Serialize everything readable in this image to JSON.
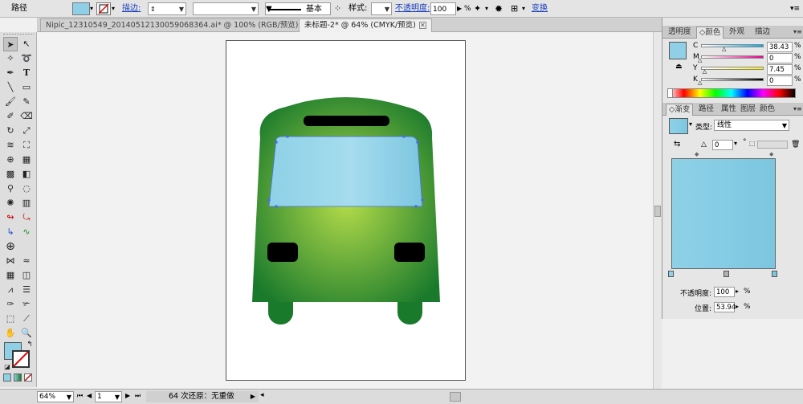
{
  "control_bar": {
    "object_type": "路径",
    "stroke_label": "描边:",
    "stroke_weight_value": "",
    "brush_label": "基本",
    "style_label": "样式:",
    "opacity_label": "不透明度:",
    "opacity_value": "100",
    "opacity_unit": "%",
    "transform_label": "变换"
  },
  "tabs": [
    {
      "label": "Nipic_12310549_20140512130059068364.ai* @ 100% (RGB/预览)"
    },
    {
      "label": "未标题-2* @ 64% (CMYK/预览)"
    }
  ],
  "color_panel": {
    "tabs": [
      "透明度",
      "颜色",
      "外观",
      "描边"
    ],
    "channels": [
      {
        "name": "C",
        "value": "38.43",
        "percent": 38.43
      },
      {
        "name": "M",
        "value": "0",
        "percent": 0
      },
      {
        "name": "Y",
        "value": "7.45",
        "percent": 7.45
      },
      {
        "name": "K",
        "value": "0",
        "percent": 0
      }
    ],
    "unit": "%",
    "fill_color": "#8fd0e6"
  },
  "gradient_panel": {
    "tabs": [
      "渐变",
      "路径",
      "属性",
      "图层",
      "颜色"
    ],
    "type_label": "类型:",
    "type_value": "线性",
    "angle_value": "0",
    "angle_unit": "°",
    "opacity_label": "不透明度:",
    "opacity_value": "100",
    "location_label": "位置:",
    "location_value": "53.94",
    "unit": "%",
    "color_start": "#8ed1e7",
    "color_end": "#7cc6e0"
  },
  "status_bar": {
    "zoom": "64%",
    "page": "1",
    "info": "64 次还原：无重做"
  },
  "colors": {
    "bus_dark": "#1a7a2c",
    "bus_light": "#b6dd4a",
    "windshield": "#8fd0e6",
    "selection": "#4a6ee0"
  }
}
